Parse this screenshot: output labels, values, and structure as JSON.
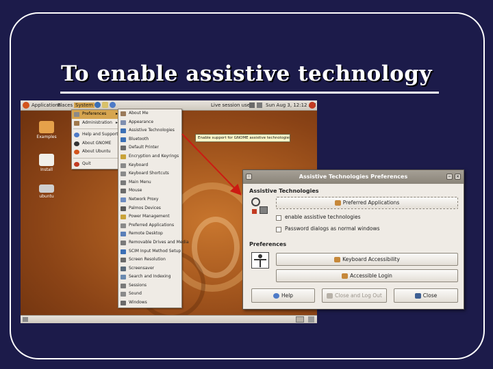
{
  "slide": {
    "title": "To enable assistive technology"
  },
  "topbar": {
    "applications": "Applications",
    "places": "Places",
    "system": "System",
    "user": "Live session user",
    "clock": "Sun Aug 3, 12:12 AM"
  },
  "desktop_icons": [
    {
      "label": "Examples"
    },
    {
      "label": "Install"
    },
    {
      "label": "ubuntu"
    }
  ],
  "system_menu": [
    {
      "label": "Preferences",
      "icon": "preferences-icon",
      "selected": true
    },
    {
      "label": "Administration",
      "icon": "administration-icon"
    },
    {
      "label": "Help and Support",
      "icon": "help-icon"
    },
    {
      "label": "About GNOME",
      "icon": "gnome-icon"
    },
    {
      "label": "About Ubuntu",
      "icon": "ubuntu-icon"
    },
    {
      "label": "Quit",
      "icon": "quit-icon"
    }
  ],
  "preferences_menu": [
    "About Me",
    "Appearance",
    "Assistive Technologies",
    "Bluetooth",
    "Default Printer",
    "Encryption and Keyrings",
    "Keyboard",
    "Keyboard Shortcuts",
    "Main Menu",
    "Mouse",
    "Network Proxy",
    "Palmos Devices",
    "Power Management",
    "Preferred Applications",
    "Remote Desktop",
    "Removable Drives and Media",
    "SCIM Input Method Setup",
    "Screen Resolution",
    "Screensaver",
    "Search and Indexing",
    "Sessions",
    "Sound",
    "Windows"
  ],
  "tooltip": "Enable support for GNOME assistive technologies at login",
  "dialog": {
    "title": "Assistive Technologies Preferences",
    "section_assistive": "Assistive Technologies",
    "preferred_apps_button": "Preferred Applications",
    "enable_checkbox": "enable assistive technologies",
    "password_checkbox": "Password dialogs as normal windows",
    "section_preferences": "Preferences",
    "keyboard_button": "Keyboard Accessibility",
    "mouse_button": "Accessible Login",
    "help_button": "Help",
    "close_logout_button": "Close and Log Out",
    "close_button": "Close"
  },
  "colors": {
    "slide_bg": "#1c1b4a",
    "menu_highlight": "#d6a54f",
    "arrow": "#cc1a12"
  }
}
